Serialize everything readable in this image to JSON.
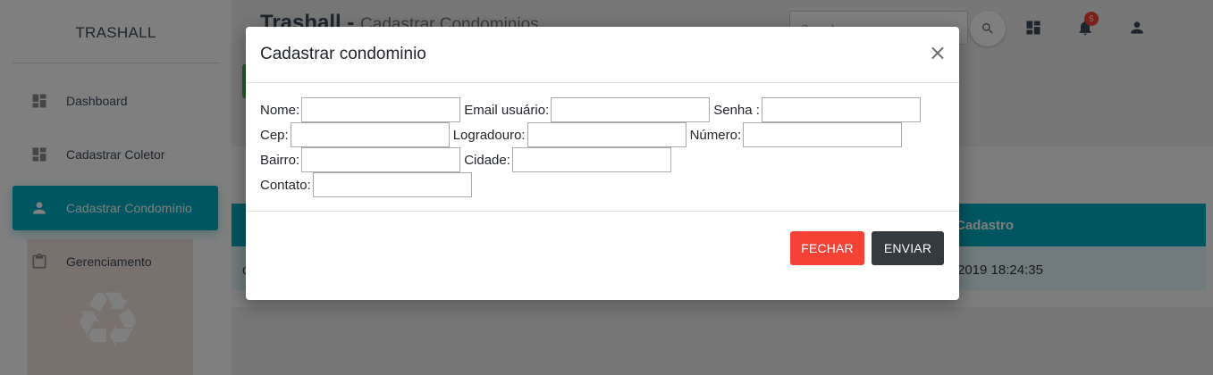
{
  "sidebar": {
    "brand": "TRASHALL",
    "items": [
      {
        "label": "Dashboard",
        "icon": "dashboard-icon",
        "active": false
      },
      {
        "label": "Cadastrar Coletor",
        "icon": "dashboard-icon",
        "active": false
      },
      {
        "label": "Cadastrar Condomínio",
        "icon": "person-icon",
        "active": true
      },
      {
        "label": "Gerenciamento",
        "icon": "clipboard-icon",
        "active": false
      }
    ]
  },
  "header": {
    "title": "Trashall -",
    "subtitle": "Cadastrar Condominios",
    "search_placeholder": "Search",
    "notification_count": "5"
  },
  "table": {
    "headers": [
      "Cadastro"
    ],
    "row_partial_first": "c",
    "row_date": "2019 18:24:35"
  },
  "modal": {
    "title": "Cadastrar condominio",
    "close_symbol": "×",
    "fields": [
      {
        "label": "Nome:",
        "value": ""
      },
      {
        "label": "Email usuário:",
        "value": ""
      },
      {
        "label": "Senha :",
        "value": ""
      },
      {
        "label": "Cep:",
        "value": ""
      },
      {
        "label": "Logradouro:",
        "value": ""
      },
      {
        "label": "Número:",
        "value": ""
      },
      {
        "label": "Bairro:",
        "value": ""
      },
      {
        "label": "Cidade:",
        "value": ""
      },
      {
        "label": "Contato:",
        "value": ""
      }
    ],
    "buttons": {
      "close": "FECHAR",
      "send": "ENVIAR"
    }
  },
  "colors": {
    "accent": "#00acc1",
    "danger": "#f44336",
    "dark": "#343a40",
    "success": "#4caf50"
  }
}
